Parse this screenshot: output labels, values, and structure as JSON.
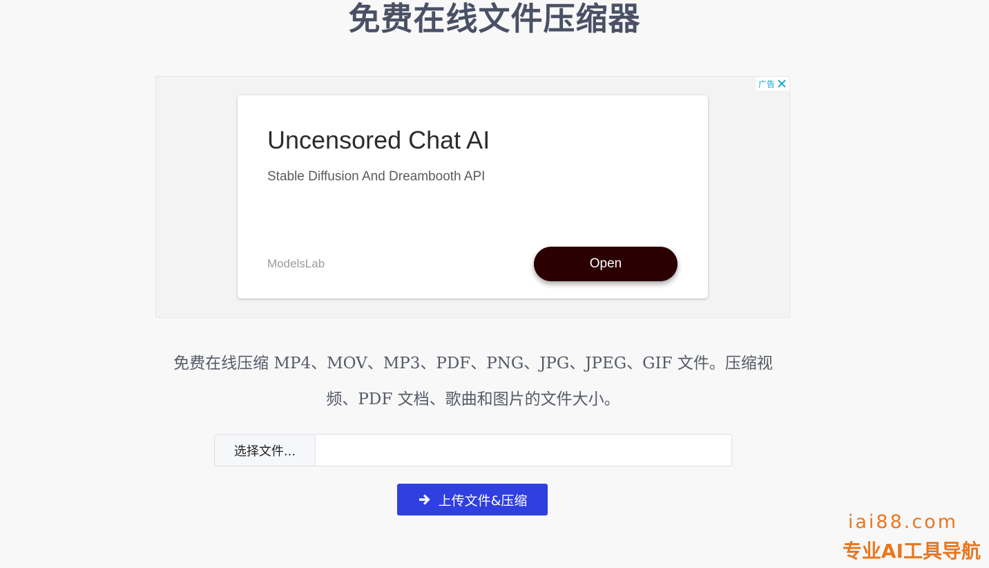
{
  "page": {
    "title": "免费在线文件压缩器",
    "description": "免费在线压缩 MP4、MOV、MP3、PDF、PNG、JPG、JPEG、GIF 文件。压缩视频、PDF 文档、歌曲和图片的文件大小。"
  },
  "ad": {
    "label": "广告",
    "close_icon": "close-icon",
    "headline": "Uncensored Chat AI",
    "subtitle": "Stable Diffusion And Dreambooth API",
    "advertiser": "ModelsLab",
    "cta_label": "Open",
    "cta_color": "#2a0000",
    "label_color": "#1aa3c8"
  },
  "form": {
    "choose_file_label": "选择文件...",
    "file_name_value": "",
    "upload_button_label": "上传文件&压缩",
    "upload_icon": "arrow-right-icon",
    "upload_color": "#2f3fe0"
  },
  "watermark": {
    "domain": "iai88.com",
    "tagline": "专业AI工具导航",
    "color": "#e8771f"
  }
}
